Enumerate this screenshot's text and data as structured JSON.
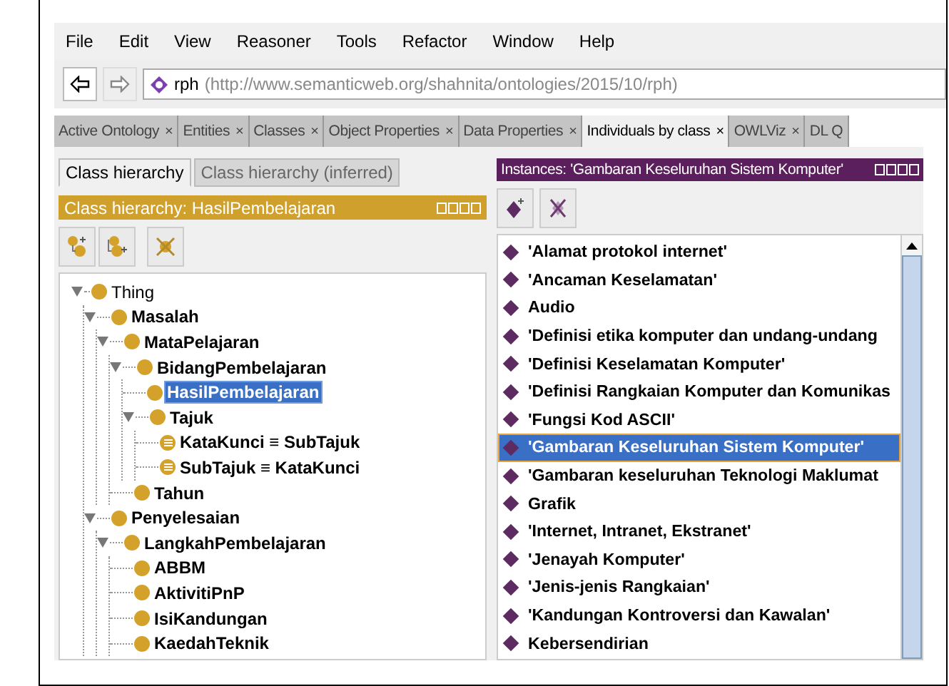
{
  "menu": [
    "File",
    "Edit",
    "View",
    "Reasoner",
    "Tools",
    "Refactor",
    "Window",
    "Help"
  ],
  "address": {
    "name": "rph",
    "iri": "(http://www.semanticweb.org/shahnita/ontologies/2015/10/rph)"
  },
  "tabs": [
    {
      "label": "Active Ontology",
      "close": "×",
      "selected": false
    },
    {
      "label": "Entities",
      "close": "×",
      "selected": false
    },
    {
      "label": "Classes",
      "close": "×",
      "selected": false
    },
    {
      "label": "Object Properties",
      "close": "×",
      "selected": false
    },
    {
      "label": "Data Properties",
      "close": "×",
      "selected": false
    },
    {
      "label": "Individuals by class",
      "close": "×",
      "selected": true
    },
    {
      "label": "OWLViz",
      "close": "×",
      "selected": false
    },
    {
      "label": "DL Q",
      "selected": false
    }
  ],
  "class_panel": {
    "subtabs": [
      {
        "label": "Class hierarchy",
        "selected": true
      },
      {
        "label": "Class hierarchy (inferred)",
        "selected": false
      }
    ],
    "header": "Class hierarchy: HasilPembelajaran",
    "tree": [
      {
        "label": "Thing",
        "kind": "root",
        "expanded": true,
        "selected": false,
        "children": [
          {
            "label": "Masalah",
            "kind": "class",
            "expanded": true,
            "selected": false,
            "children": [
              {
                "label": "MataPelajaran",
                "kind": "class",
                "expanded": true,
                "selected": false,
                "children": [
                  {
                    "label": "BidangPembelajaran",
                    "kind": "class",
                    "expanded": true,
                    "selected": false,
                    "children": [
                      {
                        "label": "HasilPembelajaran",
                        "kind": "class",
                        "selected": true
                      },
                      {
                        "label": "Tajuk",
                        "kind": "class",
                        "expanded": true,
                        "selected": false,
                        "children": [
                          {
                            "label": "KataKunci ≡ SubTajuk",
                            "kind": "equivalent",
                            "selected": false
                          },
                          {
                            "label": "SubTajuk ≡ KataKunci",
                            "kind": "equivalent",
                            "selected": false
                          }
                        ]
                      }
                    ]
                  },
                  {
                    "label": "Tahun",
                    "kind": "class",
                    "selected": false
                  }
                ]
              }
            ]
          },
          {
            "label": "Penyelesaian",
            "kind": "class",
            "expanded": true,
            "selected": false,
            "children": [
              {
                "label": "LangkahPembelajaran",
                "kind": "class",
                "expanded": true,
                "selected": false,
                "children": [
                  {
                    "label": "ABBM",
                    "kind": "class",
                    "selected": false
                  },
                  {
                    "label": "AktivitiPnP",
                    "kind": "class",
                    "selected": false
                  },
                  {
                    "label": "IsiKandungan",
                    "kind": "class",
                    "selected": false
                  },
                  {
                    "label": "KaedahTeknik",
                    "kind": "class",
                    "selected": false
                  }
                ]
              }
            ]
          }
        ]
      }
    ]
  },
  "instance_panel": {
    "header": "Instances: 'Gambaran Keseluruhan Sistem Komputer'",
    "items": [
      {
        "label": "'Alamat protokol internet'",
        "selected": false
      },
      {
        "label": "'Ancaman Keselamatan'",
        "selected": false
      },
      {
        "label": "Audio",
        "selected": false
      },
      {
        "label": "'Definisi etika komputer dan undang-undang",
        "selected": false
      },
      {
        "label": "'Definisi Keselamatan Komputer'",
        "selected": false
      },
      {
        "label": "'Definisi Rangkaian Komputer dan Komunikas",
        "selected": false
      },
      {
        "label": "'Fungsi Kod ASCII'",
        "selected": false
      },
      {
        "label": "'Gambaran Keseluruhan Sistem Komputer'",
        "selected": true
      },
      {
        "label": "'Gambaran keseluruhan Teknologi Maklumat",
        "selected": false
      },
      {
        "label": "Grafik",
        "selected": false
      },
      {
        "label": "'Internet, Intranet, Ekstranet'",
        "selected": false
      },
      {
        "label": "'Jenayah Komputer'",
        "selected": false
      },
      {
        "label": "'Jenis-jenis Rangkaian'",
        "selected": false
      },
      {
        "label": "'Kandungan Kontroversi dan Kawalan'",
        "selected": false
      },
      {
        "label": "Kebersendirian",
        "selected": false
      }
    ]
  }
}
